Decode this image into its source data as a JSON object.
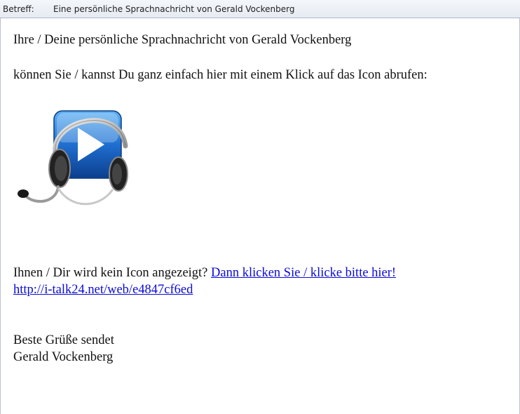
{
  "header": {
    "subject_label": "Betreff:",
    "subject_value": "Eine persönliche Sprachnachricht von Gerald Vockenberg"
  },
  "message": {
    "line1": "Ihre / Deine persönliche Sprachnachricht von Gerald Vockenberg",
    "line2": "können Sie / kannst Du ganz einfach hier mit einem Klick auf das Icon abrufen:",
    "icon": "headset-play-icon",
    "no_icon_text": "Ihnen / Dir wird kein Icon angezeigt?",
    "click_link_text": "Dann klicken Sie / klicke bitte hier!",
    "url_text": "http://i-talk24.net/web/e4847cf6ed",
    "greeting": "Beste Grüße sendet",
    "sender": "Gerald Vockenberg"
  },
  "colors": {
    "link": "#0b0bd6",
    "icon_blue": "#1f6fd0"
  }
}
